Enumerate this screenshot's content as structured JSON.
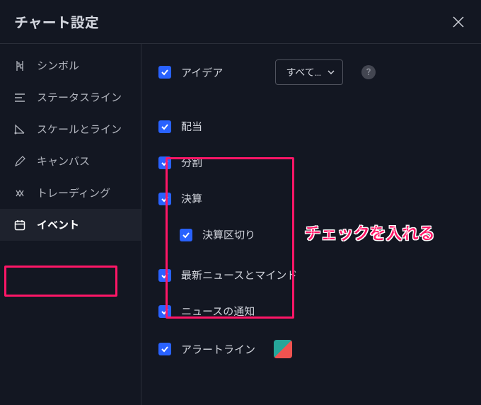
{
  "header": {
    "title": "チャート設定"
  },
  "sidebar": {
    "items": [
      {
        "label": "シンボル"
      },
      {
        "label": "ステータスライン"
      },
      {
        "label": "スケールとライン"
      },
      {
        "label": "キャンバス"
      },
      {
        "label": "トレーディング"
      },
      {
        "label": "イベント"
      }
    ]
  },
  "content": {
    "ideas": {
      "label": "アイデア",
      "dropdown": "すべて…"
    },
    "dividends": {
      "label": "配当"
    },
    "splits": {
      "label": "分割"
    },
    "earnings": {
      "label": "決算"
    },
    "earnings_break": {
      "label": "決算区切り"
    },
    "news_mind": {
      "label": "最新ニュースとマインド"
    },
    "news_notif": {
      "label": "ニュースの通知"
    },
    "alert_line": {
      "label": "アラートライン"
    }
  },
  "annotation": {
    "text": "チェックを入れる"
  }
}
